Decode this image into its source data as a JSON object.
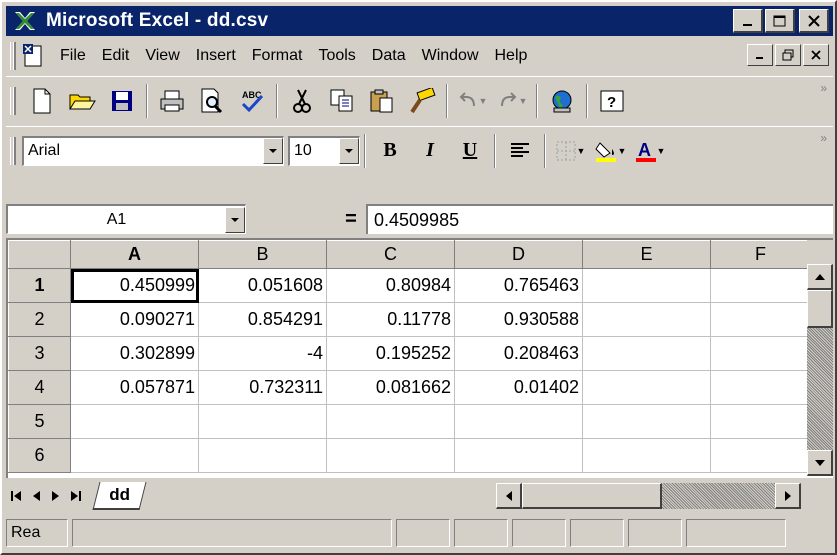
{
  "window": {
    "title": "Microsoft Excel - dd.csv",
    "app_icon": "excel-x-icon"
  },
  "menu": {
    "items": [
      "File",
      "Edit",
      "View",
      "Insert",
      "Format",
      "Tools",
      "Data",
      "Window",
      "Help"
    ]
  },
  "toolbar_standard": {
    "icons": [
      "new-icon",
      "open-icon",
      "save-icon",
      "print-icon",
      "print-preview-icon",
      "spelling-icon",
      "cut-icon",
      "copy-icon",
      "paste-icon",
      "format-painter-icon",
      "undo-icon",
      "redo-icon",
      "web-icon",
      "help-icon"
    ]
  },
  "toolbar_formatting": {
    "font": "Arial",
    "size": "10",
    "bold": "B",
    "italic": "I",
    "underline": "U"
  },
  "formula_bar": {
    "name_box": "A1",
    "equals": "=",
    "value": "0.4509985"
  },
  "grid": {
    "columns": [
      "A",
      "B",
      "C",
      "D",
      "E",
      "F"
    ],
    "rows": [
      {
        "num": "1",
        "cells": [
          "0.450999",
          "0.051608",
          "0.80984",
          "0.765463",
          "",
          ""
        ]
      },
      {
        "num": "2",
        "cells": [
          "0.090271",
          "0.854291",
          "0.11778",
          "0.930588",
          "",
          ""
        ]
      },
      {
        "num": "3",
        "cells": [
          "0.302899",
          "-4",
          "0.195252",
          "0.208463",
          "",
          ""
        ]
      },
      {
        "num": "4",
        "cells": [
          "0.057871",
          "0.732311",
          "0.081662",
          "0.01402",
          "",
          ""
        ]
      },
      {
        "num": "5",
        "cells": [
          "",
          "",
          "",
          "",
          "",
          ""
        ]
      },
      {
        "num": "6",
        "cells": [
          "",
          "",
          "",
          "",
          "",
          ""
        ]
      }
    ]
  },
  "sheet_tabs": [
    "dd"
  ],
  "status": {
    "mode": "Rea"
  }
}
